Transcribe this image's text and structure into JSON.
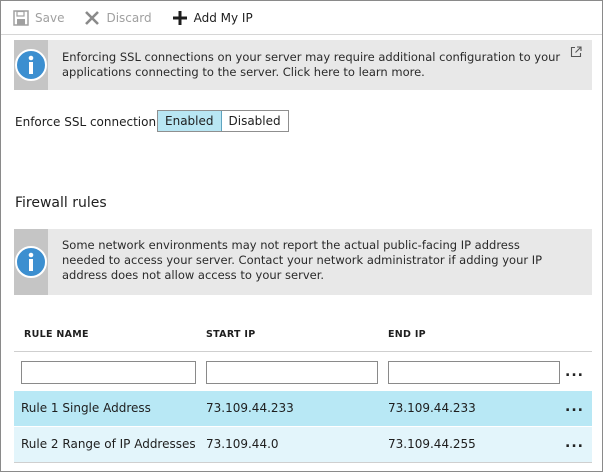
{
  "toolbar": {
    "save_label": "Save",
    "discard_label": "Discard",
    "add_ip_label": "Add My IP"
  },
  "ssl_banner": {
    "text": "Enforcing SSL connections on your server may require additional configuration to your applications connecting to the server.  Click here to learn more."
  },
  "ssl": {
    "label": "Enforce SSL connection",
    "options": [
      "Enabled",
      "Disabled"
    ],
    "selected": "Enabled"
  },
  "firewall": {
    "title": "Firewall rules",
    "banner_text": "Some network environments may not report the actual public-facing IP address needed to access your server.  Contact your network administrator if adding your IP address does not allow access to your server.",
    "columns": [
      "RULE NAME",
      "START IP",
      "END IP"
    ],
    "filter_values": [
      "",
      "",
      ""
    ],
    "more_label": "...",
    "rows": [
      {
        "name": "Rule 1 Single Address",
        "start_ip": "73.109.44.233",
        "end_ip": "73.109.44.233"
      },
      {
        "name": "Rule 2 Range of IP Addresses",
        "start_ip": "73.109.44.0",
        "end_ip": "73.109.44.255"
      }
    ]
  },
  "colors": {
    "accent": "#5fa4c0",
    "toggle_active": "#b8e6f3",
    "row_selected": "#b8e8f5",
    "row_hover": "#e3f5fb",
    "info_icon": "#3c8fd0"
  },
  "icons": [
    "save-icon",
    "discard-icon",
    "add-icon",
    "info-icon",
    "external-link-icon",
    "more-icon"
  ]
}
